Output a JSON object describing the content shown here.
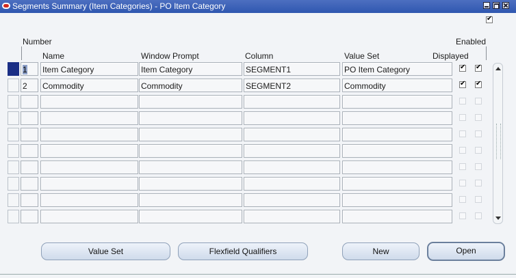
{
  "window": {
    "title": "Segments Summary (Item Categories) - PO Item Category",
    "top_checkbox_checked": true
  },
  "columns": {
    "number": "Number",
    "name": "Name",
    "window_prompt": "Window Prompt",
    "column": "Column",
    "value_set": "Value Set",
    "enabled": "Enabled",
    "displayed": "Displayed"
  },
  "rows": [
    {
      "number": "1",
      "name": "Item Category",
      "window_prompt": "Item Category",
      "column": "SEGMENT1",
      "value_set": "PO Item Category",
      "displayed": true,
      "enabled": true
    },
    {
      "number": "2",
      "name": "Commodity",
      "window_prompt": "Commodity",
      "column": "SEGMENT2",
      "value_set": "Commodity",
      "displayed": true,
      "enabled": true
    },
    {
      "number": "",
      "name": "",
      "window_prompt": "",
      "column": "",
      "value_set": "",
      "displayed": false,
      "enabled": false
    },
    {
      "number": "",
      "name": "",
      "window_prompt": "",
      "column": "",
      "value_set": "",
      "displayed": false,
      "enabled": false
    },
    {
      "number": "",
      "name": "",
      "window_prompt": "",
      "column": "",
      "value_set": "",
      "displayed": false,
      "enabled": false
    },
    {
      "number": "",
      "name": "",
      "window_prompt": "",
      "column": "",
      "value_set": "",
      "displayed": false,
      "enabled": false
    },
    {
      "number": "",
      "name": "",
      "window_prompt": "",
      "column": "",
      "value_set": "",
      "displayed": false,
      "enabled": false
    },
    {
      "number": "",
      "name": "",
      "window_prompt": "",
      "column": "",
      "value_set": "",
      "displayed": false,
      "enabled": false
    },
    {
      "number": "",
      "name": "",
      "window_prompt": "",
      "column": "",
      "value_set": "",
      "displayed": false,
      "enabled": false
    },
    {
      "number": "",
      "name": "",
      "window_prompt": "",
      "column": "",
      "value_set": "",
      "displayed": false,
      "enabled": false
    }
  ],
  "buttons": {
    "value_set": "Value Set",
    "flexfield_qualifiers": "Flexfield Qualifiers",
    "new": "New",
    "open": "Open"
  }
}
